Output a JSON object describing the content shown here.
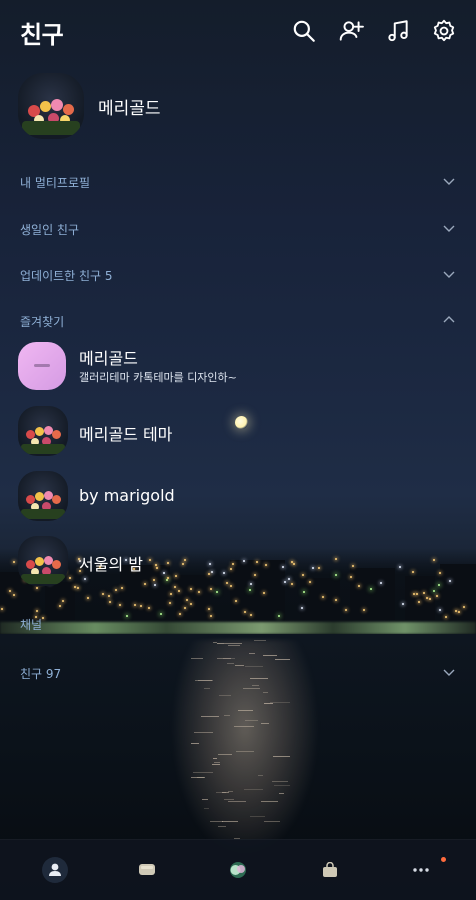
{
  "header": {
    "title": "친구",
    "icons": [
      "search-icon",
      "add-friend-icon",
      "music-icon",
      "settings-icon"
    ]
  },
  "profile": {
    "name": "메리골드"
  },
  "sections": {
    "multi_profile": "내 멀티프로필",
    "birthday": "생일인 친구",
    "updated": "업데이트한 친구 5",
    "favorites": "즐겨찾기",
    "channel": "채널",
    "friends": "친구 97"
  },
  "favorites": [
    {
      "name": "메리골드",
      "message": "갤러리테마 카톡테마를 디자인하~"
    },
    {
      "name": "메리골드 테마"
    },
    {
      "name": "by marigold"
    },
    {
      "name": "서울의 밤"
    }
  ],
  "tabbar": {
    "tabs": [
      "friends-tab",
      "chats-tab",
      "view-tab",
      "shopping-tab",
      "more-tab"
    ],
    "badge_color": "#ff6b3d"
  },
  "colors": {
    "accent_label": "#8fb0d6"
  }
}
